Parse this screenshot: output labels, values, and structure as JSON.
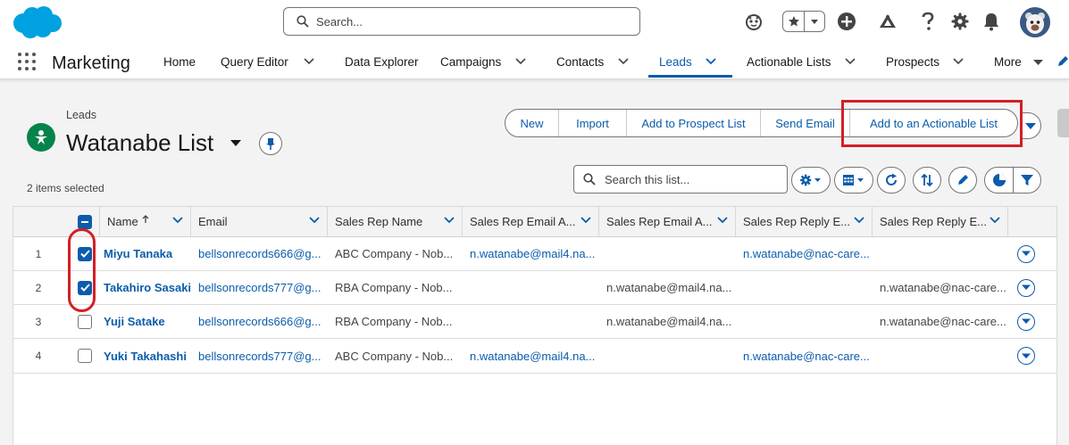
{
  "header": {
    "search_placeholder": "Search..."
  },
  "nav": {
    "app_name": "Marketing",
    "items": [
      {
        "label": "Home"
      },
      {
        "label": "Query Editor"
      },
      {
        "label": "Data Explorer"
      },
      {
        "label": "Campaigns"
      },
      {
        "label": "Contacts"
      },
      {
        "label": "Leads"
      },
      {
        "label": "Actionable Lists"
      },
      {
        "label": "Prospects"
      },
      {
        "label": "More"
      }
    ],
    "active_item": "Leads"
  },
  "page": {
    "breadcrumb": "Leads",
    "title": "Watanabe List",
    "selected_count": "2 items selected",
    "actions": [
      {
        "label": "New"
      },
      {
        "label": "Import"
      },
      {
        "label": "Add to Prospect List"
      },
      {
        "label": "Send Email"
      },
      {
        "label": "Add to an Actionable List"
      }
    ],
    "list_search_placeholder": "Search this list..."
  },
  "table": {
    "columns": [
      {
        "label": "Name",
        "sorted": "ascending"
      },
      {
        "label": "Email"
      },
      {
        "label": "Sales Rep Name"
      },
      {
        "label": "Sales Rep Email A..."
      },
      {
        "label": "Sales Rep Email A..."
      },
      {
        "label": "Sales Rep Reply E..."
      },
      {
        "label": "Sales Rep Reply E..."
      }
    ],
    "rows": [
      {
        "num": "1",
        "checked": true,
        "name": "Miyu Tanaka",
        "email": "bellsonrecords666@g...",
        "rep_name": "ABC Company - Nob...",
        "rep_email_a": "n.watanabe@mail4.na...",
        "rep_email_b": "",
        "reply_a": "n.watanabe@nac-care...",
        "reply_b": ""
      },
      {
        "num": "2",
        "checked": true,
        "name": "Takahiro Sasaki",
        "email": "bellsonrecords777@g...",
        "rep_name": "RBA Company - Nob...",
        "rep_email_a": "",
        "rep_email_b": "n.watanabe@mail4.na...",
        "reply_a": "",
        "reply_b": "n.watanabe@nac-care..."
      },
      {
        "num": "3",
        "checked": false,
        "name": "Yuji Satake",
        "email": "bellsonrecords666@g...",
        "rep_name": "RBA Company - Nob...",
        "rep_email_a": "",
        "rep_email_b": "n.watanabe@mail4.na...",
        "reply_a": "",
        "reply_b": "n.watanabe@nac-care..."
      },
      {
        "num": "4",
        "checked": false,
        "name": "Yuki Takahashi",
        "email": "bellsonrecords777@g...",
        "rep_name": "ABC Company - Nob...",
        "rep_email_a": "n.watanabe@mail4.na...",
        "rep_email_b": "",
        "reply_a": "n.watanabe@nac-care...",
        "reply_b": ""
      }
    ]
  },
  "colors": {
    "brand_blue": "#0b5cab",
    "leads_icon": "#04844b",
    "highlight_red": "#d31f26",
    "logo_blue": "#00a1e0"
  }
}
